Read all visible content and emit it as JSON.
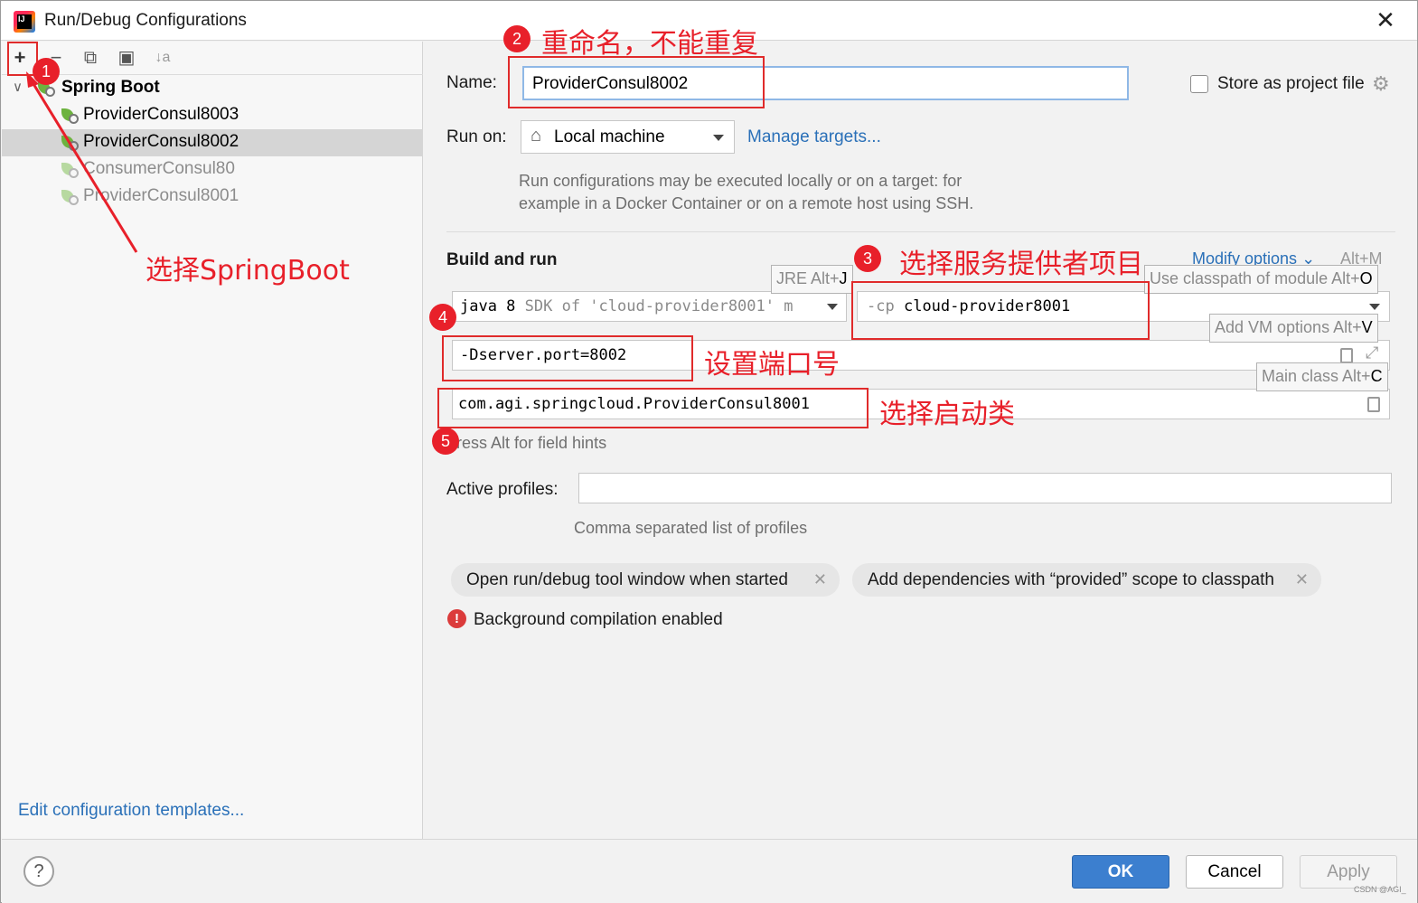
{
  "window": {
    "title": "Run/Debug Configurations"
  },
  "toolbar": {
    "add": "+",
    "remove": "−",
    "copy": "⧉",
    "folder": "▣",
    "sort": "↓a"
  },
  "tree": {
    "group_label": "Spring Boot",
    "items": [
      {
        "label": "ProviderConsul8003",
        "selected": false,
        "dimmed": false
      },
      {
        "label": "ProviderConsul8002",
        "selected": true,
        "dimmed": false
      },
      {
        "label": "ConsumerConsul80",
        "selected": false,
        "dimmed": true
      },
      {
        "label": "ProviderConsul8001",
        "selected": false,
        "dimmed": true
      }
    ],
    "edit_templates_link": "Edit configuration templates..."
  },
  "form": {
    "name_label": "Name:",
    "name_value": "ProviderConsul8002",
    "store_label": "Store as project file",
    "run_on_label": "Run on:",
    "run_on_value": "Local machine",
    "manage_targets": "Manage targets...",
    "run_on_hint_line1": "Run configurations may be executed locally or on a target: for",
    "run_on_hint_line2": "example in a Docker Container or on a remote host using SSH.",
    "build_run_title": "Build and run",
    "modify_options": "Modify options",
    "modify_shortcut": "Alt+M",
    "jre_prefix": "java 8",
    "jre_detail": " SDK of 'cloud-provider8001' m",
    "classpath_prefix": "-cp",
    "classpath_value": "cloud-provider8001",
    "vm_options_value": "-Dserver.port=8002",
    "main_class_value": "com.agi.springcloud.ProviderConsul8001",
    "field_hints": "ress Alt for field hints",
    "active_profiles_label": "Active profiles:",
    "active_profiles_value": "",
    "profiles_hint": "Comma separated list of profiles",
    "chips": [
      "Open run/debug tool window when started",
      "Add dependencies with “provided” scope to classpath"
    ],
    "background_compilation": "Background compilation enabled"
  },
  "tooltips": {
    "jre": {
      "text": "JRE Alt+",
      "key": "J"
    },
    "classpath": {
      "text": "Use classpath of module Alt+",
      "key": "O"
    },
    "vm": {
      "text": "Add VM options Alt+",
      "key": "V"
    },
    "main": {
      "text": "Main class Alt+",
      "key": "C"
    }
  },
  "buttons": {
    "ok": "OK",
    "cancel": "Cancel",
    "apply": "Apply",
    "help": "?"
  },
  "watermark": "CSDN @AGI_",
  "annotations": {
    "badge1": "1",
    "badge2": "2",
    "badge3": "3",
    "badge4": "4",
    "badge5": "5",
    "text1": "选择SpringBoot",
    "text2": "重命名，不能重复",
    "text3": "选择服务提供者项目",
    "text4": "设置端口号",
    "text5": "选择启动类"
  },
  "colors": {
    "accent": "#3c7fcf",
    "link": "#2a70b8",
    "annotation": "#e8202a",
    "selected_row": "#d5d5d5"
  }
}
